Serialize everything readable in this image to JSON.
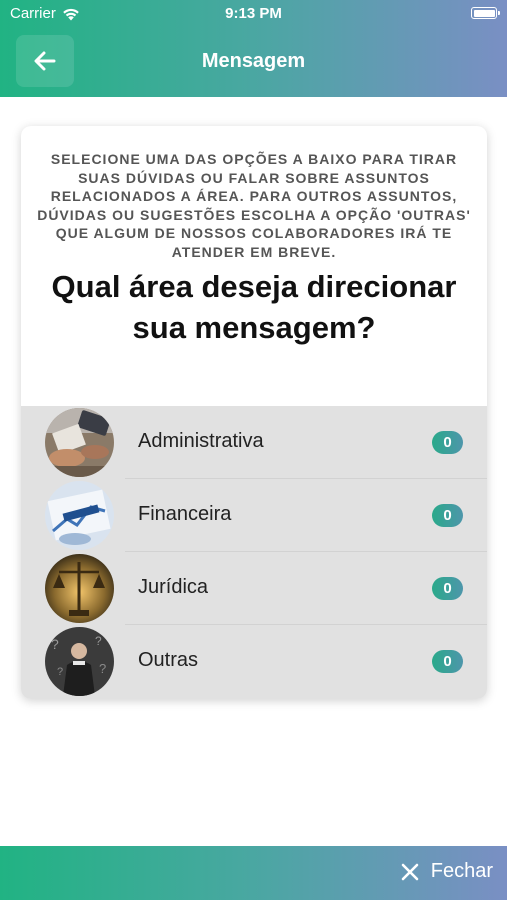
{
  "status_bar": {
    "carrier": "Carrier",
    "time": "9:13 PM"
  },
  "header": {
    "title": "Mensagem",
    "back_icon": "arrow-left-icon"
  },
  "card": {
    "instructions": "SELECIONE UMA DAS OPÇÕES A BAIXO PARA TIRAR SUAS DÚVIDAS OU FALAR SOBRE ASSUNTOS RELACIONADOS A ÁREA. PARA OUTROS ASSUNTOS, DÚVIDAS OU SUGESTÕES ESCOLHA A OPÇÃO 'OUTRAS' QUE ALGUM DE NOSSOS COLABORADORES IRÁ TE ATENDER EM BREVE.",
    "question": "Qual área deseja direcionar sua mensagem?",
    "areas": [
      {
        "label": "Administrativa",
        "count": "0"
      },
      {
        "label": "Financeira",
        "count": "0"
      },
      {
        "label": "Jurídica",
        "count": "0"
      },
      {
        "label": "Outras",
        "count": "0"
      }
    ]
  },
  "footer": {
    "close_label": "Fechar",
    "close_icon": "close-icon"
  },
  "colors": {
    "gradient_start": "#21b383",
    "gradient_end": "#7a8fc4",
    "list_bg": "#e1e1e1"
  }
}
